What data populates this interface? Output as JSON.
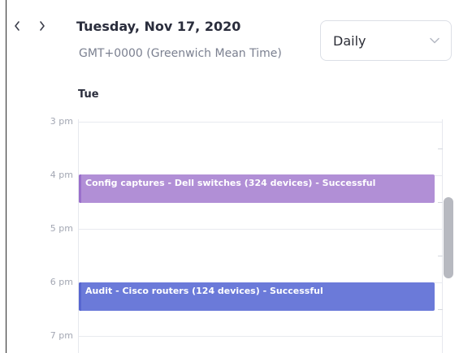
{
  "header": {
    "date_title": "Tuesday, Nov 17, 2020",
    "timezone": "GMT+0000 (Greenwich Mean Time)",
    "prev_icon": "chevron-left-icon",
    "next_icon": "chevron-right-icon"
  },
  "view_select": {
    "value": "Daily",
    "icon": "chevron-down-icon"
  },
  "calendar": {
    "day_label": "Tue",
    "hours": [
      "3 pm",
      "4 pm",
      "5 pm",
      "6 pm",
      "7 pm"
    ],
    "events": [
      {
        "title": "Config captures - Dell switches (324 devices) - Successful",
        "color": "#b18fd6",
        "accent_color": "#9a6fcb"
      },
      {
        "title": "Audit - Cisco routers (124 devices) - Successful",
        "color": "#6b7ad9",
        "accent_color": "#5766d0"
      }
    ]
  },
  "colors": {
    "text_primary": "#2a2d3c",
    "text_muted": "#7b8090",
    "gridline": "#e8eaef"
  }
}
